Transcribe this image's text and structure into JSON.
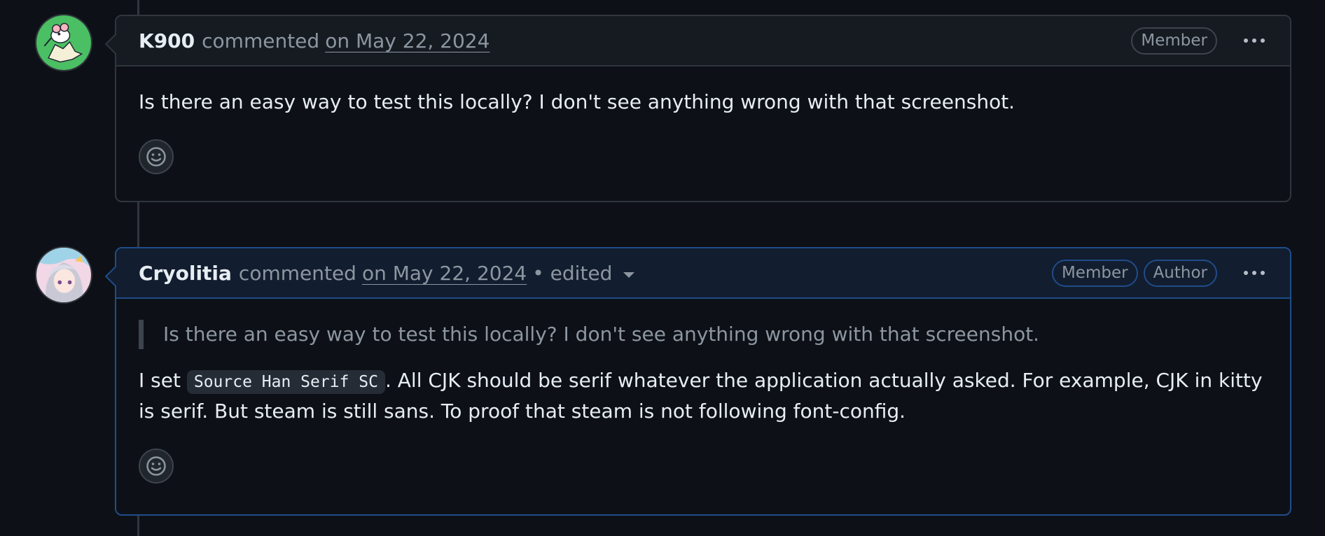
{
  "comments": [
    {
      "author": "K900",
      "action": "commented",
      "date": "on May 22, 2024",
      "badges": [
        "Member"
      ],
      "body": "Is there an easy way to test this locally? I don't see anything wrong with that screenshot.",
      "avatar": "k900-avatar"
    },
    {
      "author": "Cryolitia",
      "action": "commented",
      "date": "on May 22, 2024",
      "edited": "• edited",
      "badges": [
        "Member",
        "Author"
      ],
      "quote": "Is there an easy way to test this locally? I don't see anything wrong with that screenshot.",
      "body_pre": "I set ",
      "code": "Source Han Serif SC",
      "body_post": ". All CJK should be serif whatever the application actually asked. For example, CJK in kitty is serif. But steam is still sans. To proof that steam is not following font-config.",
      "avatar": "cryolitia-avatar"
    }
  ],
  "icons": {
    "reaction": "smiley-icon",
    "menu": "kebab-horizontal-icon",
    "edited": "triangle-down-icon"
  },
  "colors": {
    "background": "#0d1117",
    "header": "#161b22",
    "author_header": "#121d2f",
    "border": "#30363d",
    "author_border": "#1f4d8a",
    "muted_text": "#8d96a0"
  }
}
